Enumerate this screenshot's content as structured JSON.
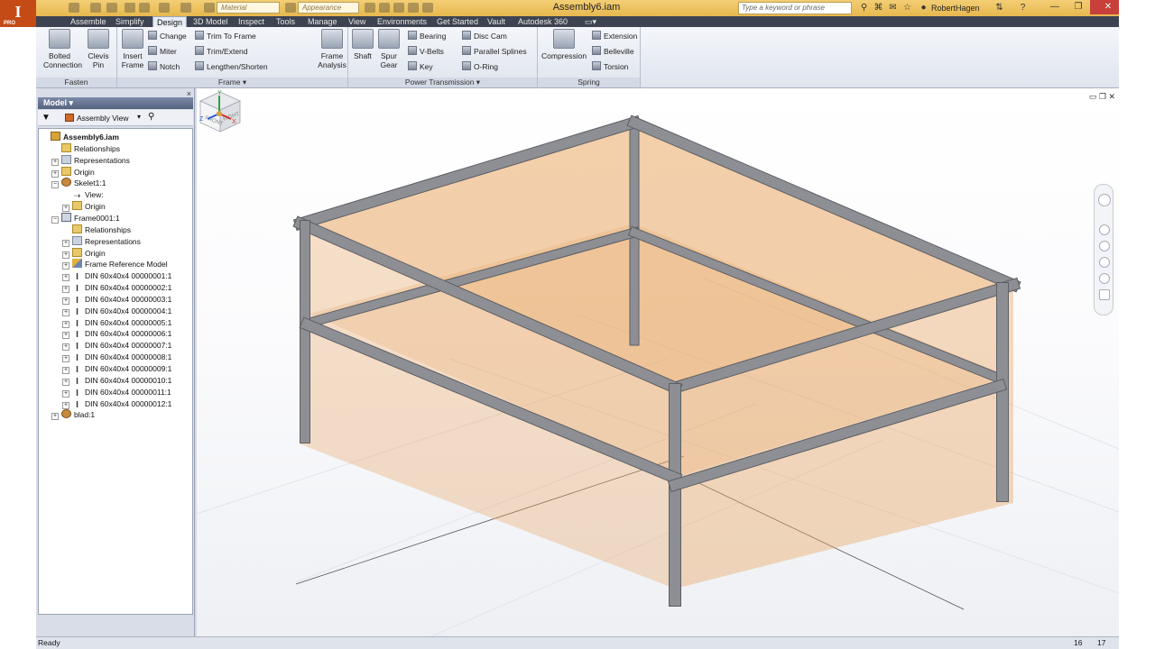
{
  "app": {
    "logo_letter": "I",
    "logo_sub": "PRO",
    "document_title": "Assembly6.iam",
    "material_combo": "Material",
    "appearance_combo": "Appearance",
    "search_placeholder": "Type a keyword or phrase",
    "user_name": "RobertHagen",
    "min_glyph": "—",
    "restore_glyph": "❐",
    "close_glyph": "✕"
  },
  "ribbon_tabs": [
    "Assemble",
    "Simplify",
    "Design",
    "3D Model",
    "Inspect",
    "Tools",
    "Manage",
    "View",
    "Environments",
    "Get Started",
    "Vault",
    "Autodesk 360"
  ],
  "active_tab": "Design",
  "ribbon": {
    "fasten": {
      "label": "Fasten",
      "bolted_connection": "Bolted Connection",
      "clevis_pin": "Clevis Pin"
    },
    "frame": {
      "label": "Frame ▾",
      "insert_frame": "Insert Frame",
      "change": "Change",
      "miter": "Miter",
      "notch": "Notch",
      "trim_to_frame": "Trim To Frame",
      "trim_extend": "Trim/Extend",
      "lengthen_shorten": "Lengthen/Shorten",
      "frame_analysis": "Frame Analysis"
    },
    "power_transmission": {
      "label": "Power Transmission ▾",
      "shaft": "Shaft",
      "spur_gear": "Spur Gear",
      "bearing": "Bearing",
      "v_belts": "V-Belts",
      "key": "Key",
      "disc_cam": "Disc Cam",
      "parallel_splines": "Parallel Splines",
      "o_ring": "O-Ring"
    },
    "spring": {
      "label": "Spring",
      "compression": "Compression",
      "extension": "Extension",
      "belleville": "Belleville",
      "torsion": "Torsion"
    }
  },
  "browser": {
    "title": "Model ▾",
    "close_glyph": "×",
    "view_selector": "Assembly View",
    "tree": [
      {
        "label": "Assembly6.iam",
        "icon": "assembly-icon",
        "level": 0,
        "expander": "",
        "bold": true
      },
      {
        "label": "Relationships",
        "icon": "folder-icon",
        "level": 1,
        "expander": ""
      },
      {
        "label": "Representations",
        "icon": "representations-icon",
        "level": 1,
        "expander": "+"
      },
      {
        "label": "Origin",
        "icon": "folder-icon",
        "level": 1,
        "expander": "+"
      },
      {
        "label": "Skelet1:1",
        "icon": "part-icon",
        "level": 1,
        "expander": "−"
      },
      {
        "label": "View:",
        "icon": "view-icon",
        "level": 2,
        "expander": ""
      },
      {
        "label": "Origin",
        "icon": "folder-icon",
        "level": 2,
        "expander": "+"
      },
      {
        "label": "Frame0001:1",
        "icon": "frame-icon",
        "level": 1,
        "expander": "−"
      },
      {
        "label": "Relationships",
        "icon": "folder-icon",
        "level": 2,
        "expander": ""
      },
      {
        "label": "Representations",
        "icon": "representations-icon",
        "level": 2,
        "expander": "+"
      },
      {
        "label": "Origin",
        "icon": "folder-icon",
        "level": 2,
        "expander": "+"
      },
      {
        "label": "Frame Reference Model",
        "icon": "reference-model-icon",
        "level": 2,
        "expander": "+"
      },
      {
        "label": "DIN 60x40x4 00000001:1",
        "icon": "beam-icon",
        "level": 2,
        "expander": "+"
      },
      {
        "label": "DIN 60x40x4 00000002:1",
        "icon": "beam-icon",
        "level": 2,
        "expander": "+"
      },
      {
        "label": "DIN 60x40x4 00000003:1",
        "icon": "beam-icon",
        "level": 2,
        "expander": "+"
      },
      {
        "label": "DIN 60x40x4 00000004:1",
        "icon": "beam-icon",
        "level": 2,
        "expander": "+"
      },
      {
        "label": "DIN 60x40x4 00000005:1",
        "icon": "beam-icon",
        "level": 2,
        "expander": "+"
      },
      {
        "label": "DIN 60x40x4 00000006:1",
        "icon": "beam-icon",
        "level": 2,
        "expander": "+"
      },
      {
        "label": "DIN 60x40x4 00000007:1",
        "icon": "beam-icon",
        "level": 2,
        "expander": "+"
      },
      {
        "label": "DIN 60x40x4 00000008:1",
        "icon": "beam-icon",
        "level": 2,
        "expander": "+"
      },
      {
        "label": "DIN 60x40x4 00000009:1",
        "icon": "beam-icon",
        "level": 2,
        "expander": "+"
      },
      {
        "label": "DIN 60x40x4 00000010:1",
        "icon": "beam-icon",
        "level": 2,
        "expander": "+"
      },
      {
        "label": "DIN 60x40x4 00000011:1",
        "icon": "beam-icon",
        "level": 2,
        "expander": "+"
      },
      {
        "label": "DIN 60x40x4 00000012:1",
        "icon": "beam-icon",
        "level": 2,
        "expander": "+"
      },
      {
        "label": "blad:1",
        "icon": "part-icon",
        "level": 1,
        "expander": "+"
      }
    ]
  },
  "viewcube": {
    "front": "FRONT",
    "right": "RIGHT"
  },
  "triad": {
    "x": "X",
    "y": "Y",
    "z": "Z"
  },
  "status": {
    "text": "Ready",
    "count1": "16",
    "count2": "17"
  },
  "colors": {
    "glass": "#e9a764",
    "steel": "#8d8f94",
    "accent": "#e7b84f"
  }
}
